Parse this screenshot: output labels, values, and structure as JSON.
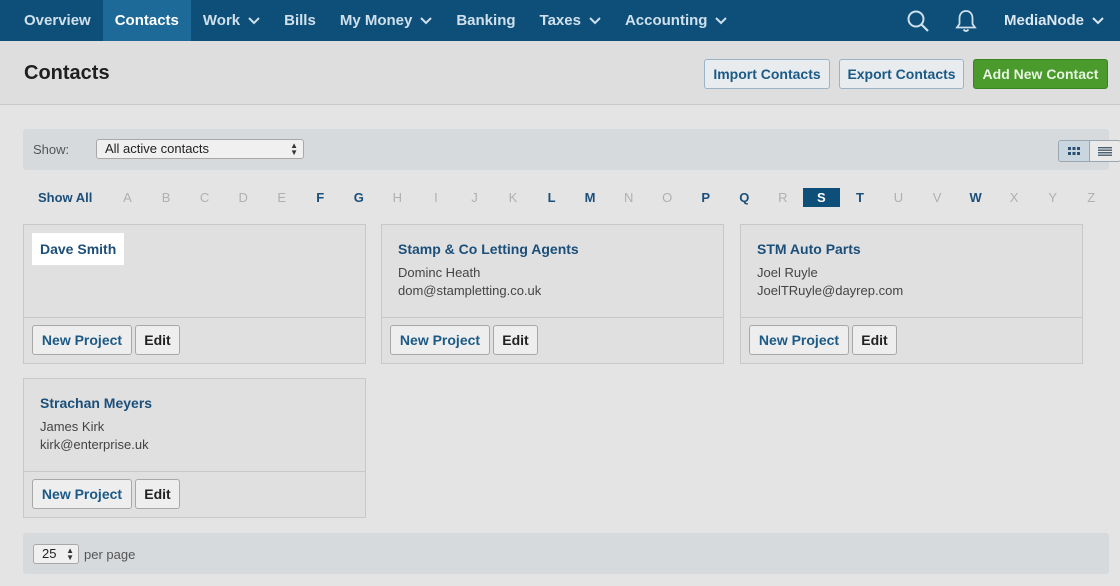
{
  "nav": {
    "items": [
      {
        "label": "Overview",
        "dropdown": false
      },
      {
        "label": "Contacts",
        "dropdown": false,
        "active": true
      },
      {
        "label": "Work",
        "dropdown": true
      },
      {
        "label": "Bills",
        "dropdown": false
      },
      {
        "label": "My Money",
        "dropdown": true
      },
      {
        "label": "Banking",
        "dropdown": false
      },
      {
        "label": "Taxes",
        "dropdown": true
      },
      {
        "label": "Accounting",
        "dropdown": true
      }
    ],
    "user": "MediaNode",
    "icons": [
      "search-icon",
      "bell-icon"
    ],
    "colors": {
      "bar": "#0d4f78",
      "active": "#1d6a98"
    }
  },
  "header": {
    "title": "Contacts",
    "import_label": "Import Contacts",
    "export_label": "Export Contacts",
    "add_label": "Add New Contact",
    "add_color": "#4a9a2c"
  },
  "filter": {
    "show_label": "Show:",
    "show_value": "All active contacts",
    "view_modes": [
      "grid-view-icon",
      "list-view-icon"
    ],
    "active_view": "grid"
  },
  "alphabet": {
    "show_all": "Show All",
    "letters": [
      "A",
      "B",
      "C",
      "D",
      "E",
      "F",
      "G",
      "H",
      "I",
      "J",
      "K",
      "L",
      "M",
      "N",
      "O",
      "P",
      "Q",
      "R",
      "S",
      "T",
      "U",
      "V",
      "W",
      "X",
      "Y",
      "Z"
    ],
    "with_contacts": [
      "F",
      "G",
      "L",
      "M",
      "P",
      "Q",
      "S",
      "T",
      "W"
    ],
    "selected": "S"
  },
  "contacts": [
    {
      "name": "Dave Smith",
      "person": "",
      "email": "",
      "highlighted": true
    },
    {
      "name": "Stamp & Co Letting Agents",
      "person": "Dominc Heath",
      "email": "dom@stampletting.co.uk"
    },
    {
      "name": "STM Auto Parts",
      "person": "Joel Ruyle",
      "email": "JoelTRuyle@dayrep.com"
    },
    {
      "name": "Strachan Meyers",
      "person": "James Kirk",
      "email": "kirk@enterprise.uk"
    }
  ],
  "card_actions": {
    "new_project": "New Project",
    "edit": "Edit"
  },
  "pagination": {
    "per_page_value": "25",
    "per_page_label": "per page"
  }
}
